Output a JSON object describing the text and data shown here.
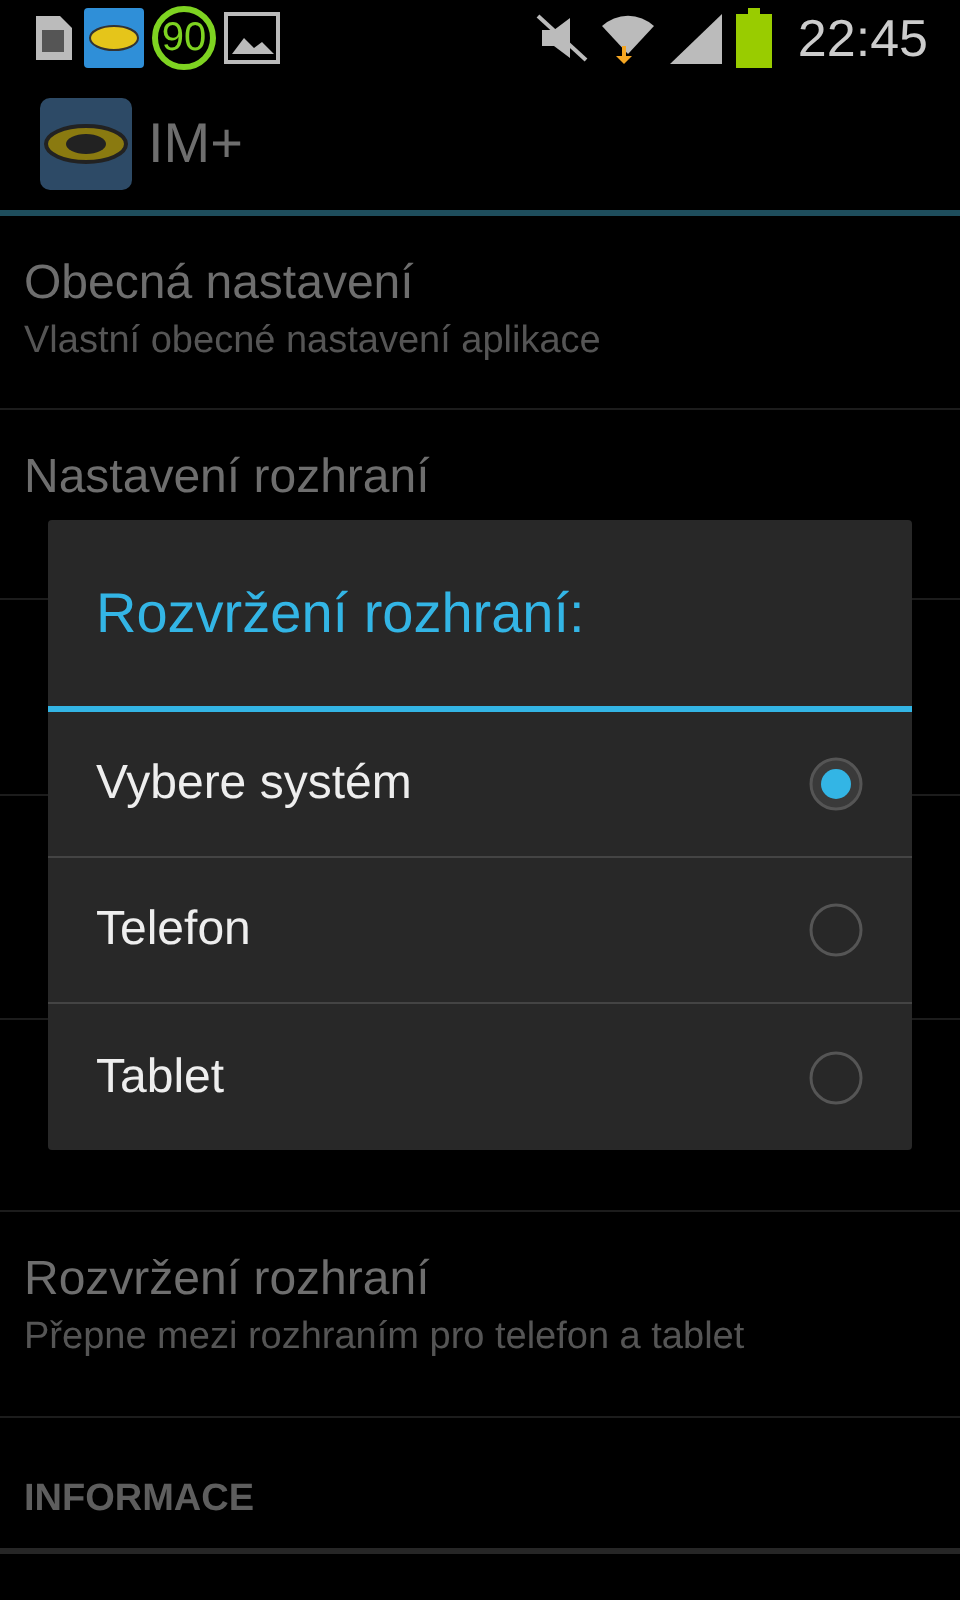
{
  "status_bar": {
    "badge": "90",
    "time": "22:45"
  },
  "action_bar": {
    "title": "IM+"
  },
  "settings": [
    {
      "kind": "item",
      "title": "Obecná nastavení",
      "summary": "Vlastní obecné nastavení aplikace"
    },
    {
      "kind": "item",
      "title": "Nastavení rozhraní"
    },
    {
      "kind": "item",
      "title": "Rozvržení rozhraní",
      "summary": "Přepne mezi rozhraním pro telefon a tablet"
    },
    {
      "kind": "header",
      "title": "INFORMACE"
    }
  ],
  "dialog": {
    "title": "Rozvržení rozhraní:",
    "options": [
      {
        "label": "Vybere systém",
        "selected": true
      },
      {
        "label": "Telefon",
        "selected": false
      },
      {
        "label": "Tablet",
        "selected": false
      }
    ]
  }
}
